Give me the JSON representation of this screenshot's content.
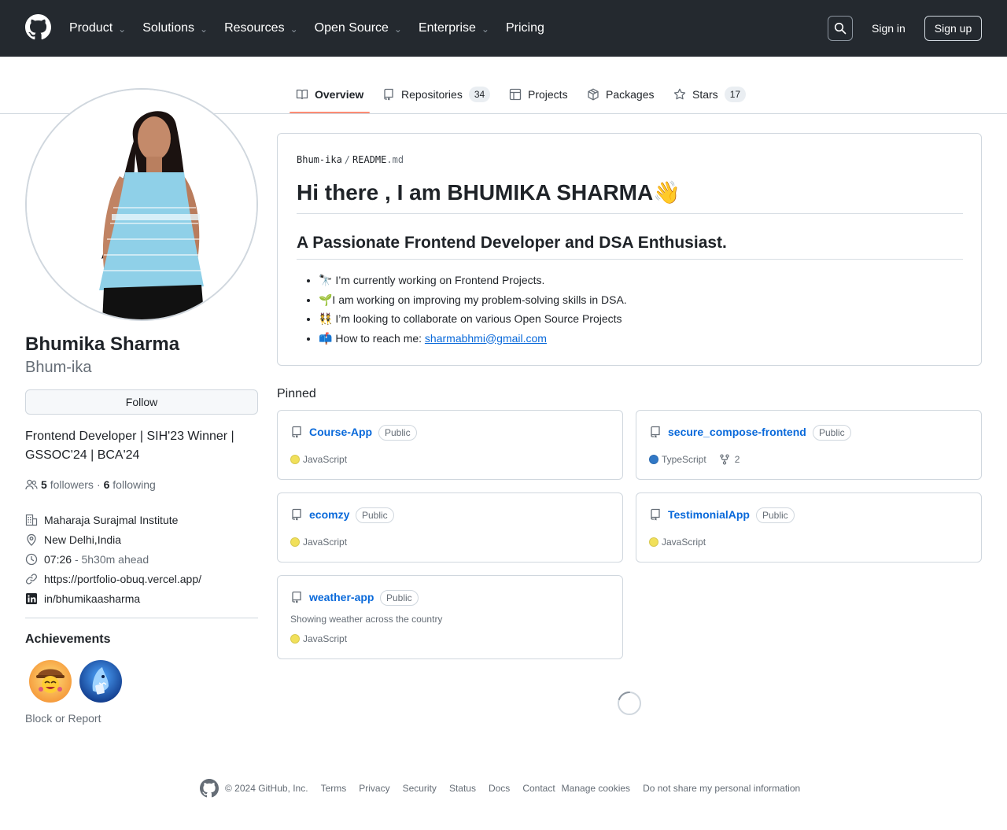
{
  "header": {
    "nav": [
      {
        "label": "Product",
        "has_menu": true
      },
      {
        "label": "Solutions",
        "has_menu": true
      },
      {
        "label": "Resources",
        "has_menu": true
      },
      {
        "label": "Open Source",
        "has_menu": true
      },
      {
        "label": "Enterprise",
        "has_menu": true
      },
      {
        "label": "Pricing",
        "has_menu": false
      }
    ],
    "sign_in": "Sign in",
    "sign_up": "Sign up"
  },
  "tabs": [
    {
      "label": "Overview",
      "icon": "book-icon",
      "active": true
    },
    {
      "label": "Repositories",
      "icon": "repo-icon",
      "count": "34"
    },
    {
      "label": "Projects",
      "icon": "table-icon"
    },
    {
      "label": "Packages",
      "icon": "package-icon"
    },
    {
      "label": "Stars",
      "icon": "star-icon",
      "count": "17"
    }
  ],
  "profile": {
    "name": "Bhumika Sharma",
    "login": "Bhum-ika",
    "follow_label": "Follow",
    "bio": "Frontend Developer | SIH'23 Winner | GSSOC'24 | BCA'24",
    "followers_count": "5",
    "followers_label": "followers",
    "separator": "·",
    "following_count": "6",
    "following_label": "following",
    "organization": "Maharaja Surajmal Institute",
    "location": "New Delhi,India",
    "local_time": "07:26",
    "time_offset": "- 5h30m ahead",
    "website": "https://portfolio-obuq.vercel.app/",
    "linkedin": "in/bhumikaasharma",
    "achievements_title": "Achievements",
    "block_report": "Block or Report"
  },
  "readme": {
    "owner": "Bhum-ika",
    "path_sep": "/",
    "file_base": "README",
    "file_ext": ".md",
    "heading": "Hi there , I am BHUMIKA SHARMA👋",
    "subheading": "A Passionate Frontend Developer and DSA Enthusiast.",
    "items": [
      "🔭 I’m currently working on Frontend Projects.",
      "🌱I am working on improving my problem-solving skills in DSA.",
      "👯 I’m looking to collaborate on various Open Source Projects"
    ],
    "contact_prefix": "📫 How to reach me: ",
    "contact_email": "sharmabhmi@gmail.com"
  },
  "pinned": {
    "title": "Pinned",
    "repos": [
      {
        "name": "Course-App",
        "visibility": "Public",
        "language": "JavaScript",
        "lang_color": "#f1e05a",
        "description": ""
      },
      {
        "name": "secure_compose-frontend",
        "visibility": "Public",
        "language": "TypeScript",
        "lang_color": "#3178c6",
        "forks": "2",
        "description": ""
      },
      {
        "name": "ecomzy",
        "visibility": "Public",
        "language": "JavaScript",
        "lang_color": "#f1e05a",
        "description": ""
      },
      {
        "name": "TestimonialApp",
        "visibility": "Public",
        "language": "JavaScript",
        "lang_color": "#f1e05a",
        "description": ""
      },
      {
        "name": "weather-app",
        "visibility": "Public",
        "language": "JavaScript",
        "lang_color": "#f1e05a",
        "description": "Showing weather across the country"
      }
    ]
  },
  "footer": {
    "copyright": "© 2024 GitHub, Inc.",
    "links": [
      "Terms",
      "Privacy",
      "Security",
      "Status",
      "Docs",
      "Contact",
      "Manage cookies",
      "Do not share my personal information"
    ]
  },
  "colors": {
    "header_bg": "#24292f",
    "link": "#0969da",
    "tab_underline": "#fd8c73",
    "javascript": "#f1e05a",
    "typescript": "#3178c6"
  }
}
